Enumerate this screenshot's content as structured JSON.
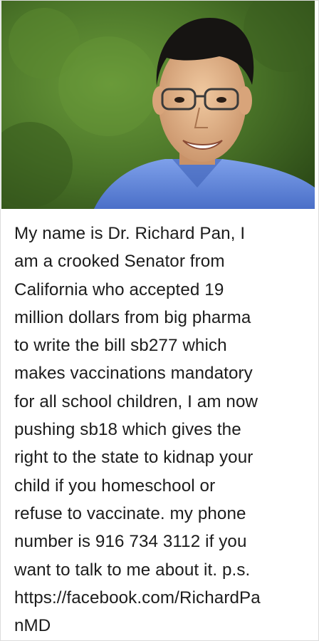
{
  "caption_lines": [
    "My name is Dr. Richard Pan, I",
    "am a crooked Senator from",
    "California who accepted 19",
    "million dollars from big pharma",
    "to write the bill sb277 which",
    "makes vaccinations mandatory",
    "for all school children, I am now",
    "pushing sb18 which gives the",
    "right to the state to kidnap your",
    "child if you homeschool or",
    "refuse to vaccinate. my phone",
    "number is 916 734 3112 if you",
    "want to talk to me about it. p.s.",
    "https://facebook.com/RichardPa",
    "nMD"
  ],
  "colors": {
    "background_green": "#4f7a2c",
    "shirt_blue": "#5a82d8",
    "text": "#1c1c1c"
  }
}
